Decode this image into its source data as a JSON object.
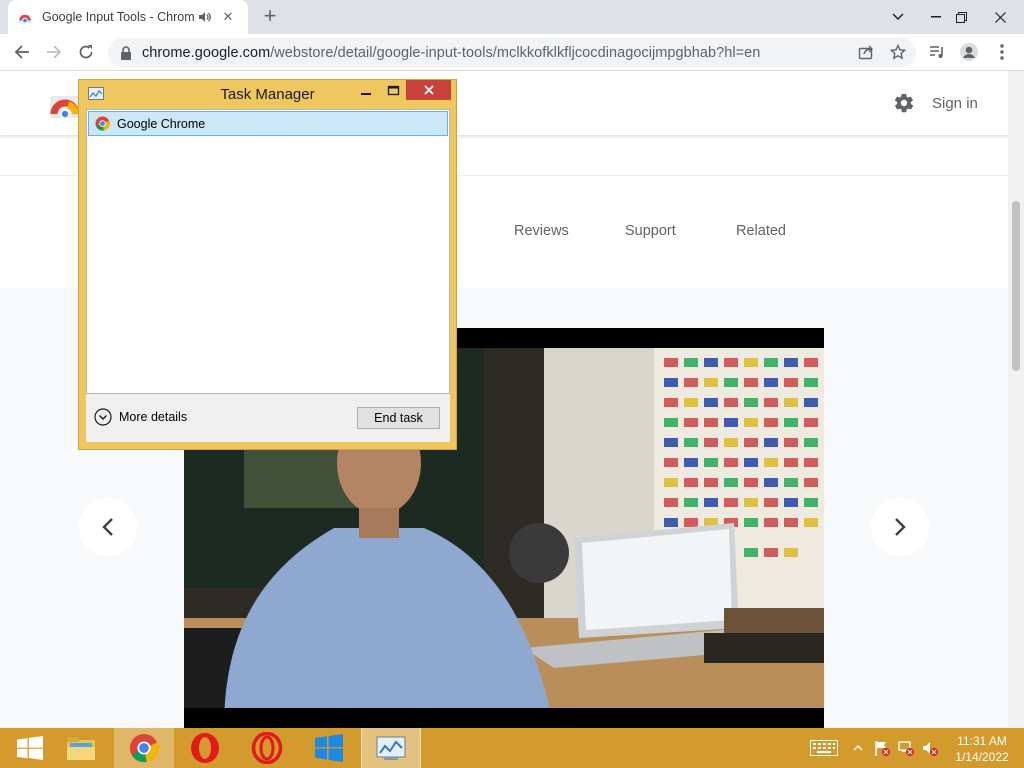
{
  "browser": {
    "tab_title": "Google Input Tools - Chrome Web Store",
    "url_domain": "chrome.google.com",
    "url_path": "/webstore/detail/google-input-tools/mclkkofklkfljcocdinagocijmpgbhab?hl=en"
  },
  "store": {
    "sign_in": "Sign in",
    "tabs": [
      "Reviews",
      "Support",
      "Related"
    ]
  },
  "task_manager": {
    "title": "Task Manager",
    "apps": [
      "Google Chrome"
    ],
    "more_details": "More details",
    "end_task": "End task"
  },
  "taskbar": {
    "time": "11:31 AM",
    "date": "1/14/2022",
    "color": "#d39b2e"
  }
}
